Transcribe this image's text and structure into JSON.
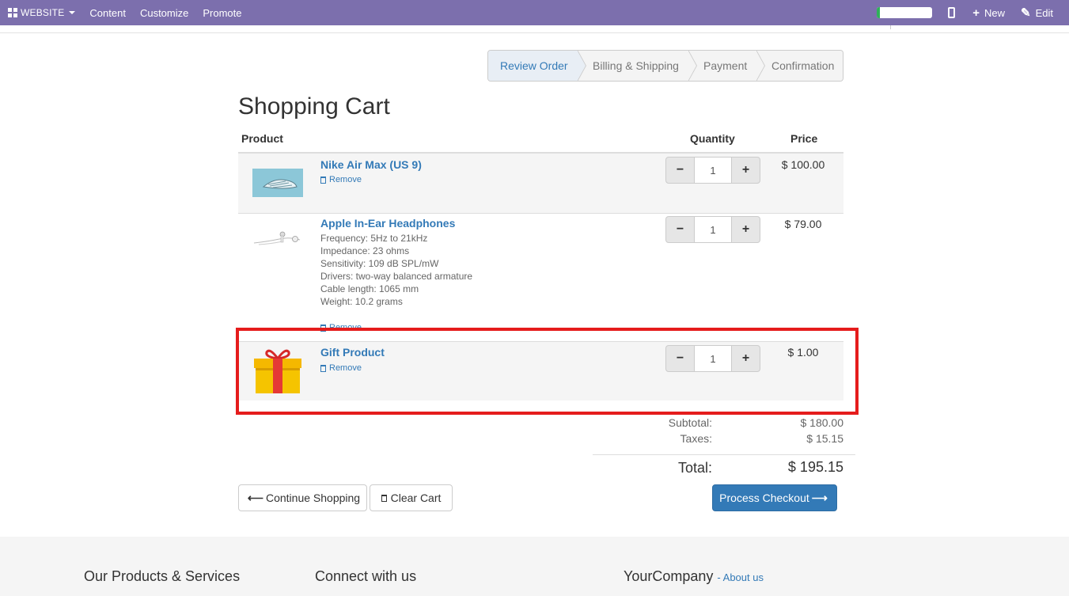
{
  "topbar": {
    "website_label": "WEBSITE",
    "menu": [
      "Content",
      "Customize",
      "Promote"
    ],
    "progress_fraction": 0.05,
    "new_label": "New",
    "edit_label": "Edit"
  },
  "wizard": {
    "steps": [
      "Review Order",
      "Billing & Shipping",
      "Payment",
      "Confirmation"
    ],
    "active_index": 0
  },
  "page_title": "Shopping Cart",
  "table": {
    "headers": {
      "product": "Product",
      "quantity": "Quantity",
      "price": "Price"
    },
    "rows": [
      {
        "name": "Nike Air Max (US 9)",
        "description": [],
        "remove_label": "Remove",
        "quantity": "1",
        "price": "$ 100.00"
      },
      {
        "name": "Apple In-Ear Headphones",
        "description": [
          "Frequency: 5Hz to 21kHz",
          "Impedance: 23 ohms",
          "Sensitivity: 109 dB SPL/mW",
          "Drivers: two-way balanced armature",
          "Cable length: 1065 mm",
          "Weight: 10.2 grams"
        ],
        "remove_label": "Remove",
        "quantity": "1",
        "price": "$ 79.00"
      },
      {
        "name": "Gift Product",
        "description": [],
        "remove_label": "Remove",
        "quantity": "1",
        "price": "$ 1.00"
      }
    ]
  },
  "totals": {
    "subtotal_label": "Subtotal:",
    "subtotal": "$ 180.00",
    "taxes_label": "Taxes:",
    "taxes": "$ 15.15",
    "total_label": "Total:",
    "total": "$ 195.15"
  },
  "buttons": {
    "continue_shopping": "Continue Shopping",
    "clear_cart": "Clear Cart",
    "process_checkout": "Process Checkout"
  },
  "footer": {
    "col1_title": "Our Products & Services",
    "col2_title": "Connect with us",
    "col3_title": "YourCompany",
    "col3_link": "- About us"
  },
  "colors": {
    "topbar": "#7c6fad",
    "link": "#337ab7",
    "highlight": "#e51c1c",
    "primary": "#337ab7"
  }
}
